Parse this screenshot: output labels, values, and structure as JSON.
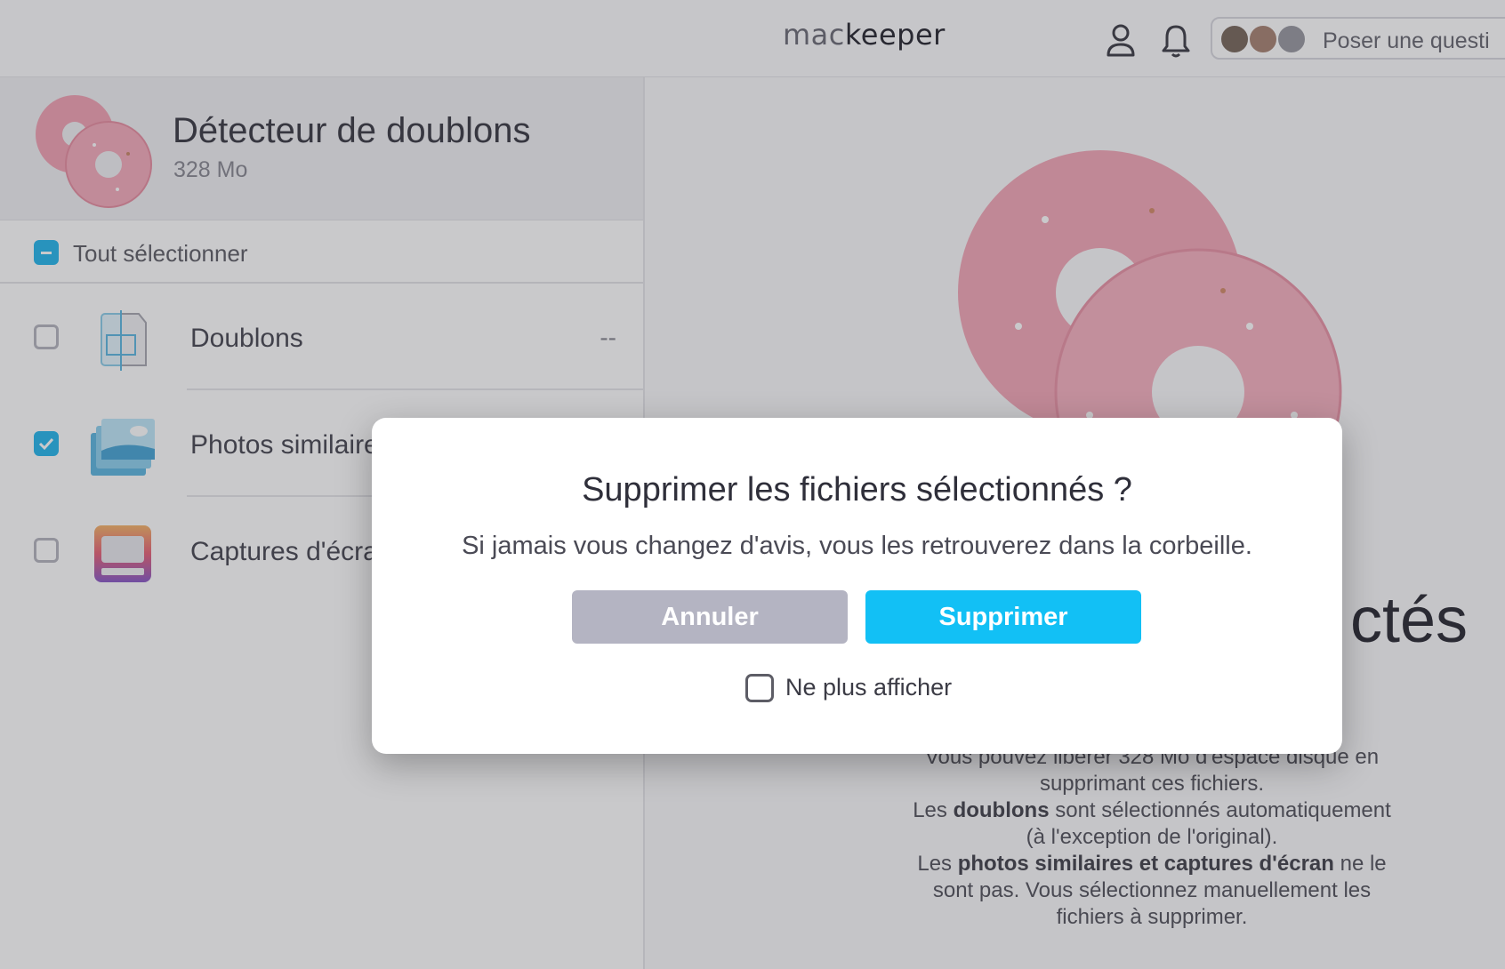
{
  "topbar": {
    "logo_mac": "mac",
    "logo_keeper": "keeper",
    "ask_placeholder": "Poser une questi"
  },
  "tool": {
    "title": "Détecteur de doublons",
    "size": "328 Mo"
  },
  "select_all": {
    "label": "Tout sélectionner",
    "state": "partial"
  },
  "categories": [
    {
      "label": "Doublons",
      "value": "--",
      "checked": false,
      "icon": "duplicate-files-icon"
    },
    {
      "label": "Photos similaire",
      "value": "",
      "checked": true,
      "icon": "similar-photos-icon"
    },
    {
      "label": "Captures d'écra",
      "value": "",
      "checked": false,
      "icon": "screenshots-icon"
    }
  ],
  "right": {
    "heading_fragment": "ctés",
    "desc_line1": "Vous pouvez libérer 328 Mo d'espace disque en supprimant ces fichiers.",
    "desc_line2_pre": "Les ",
    "desc_line2_bold": "doublons",
    "desc_line2_post": " sont sélectionnés automatiquement (à l'exception de l'original).",
    "desc_line3_pre": "Les ",
    "desc_line3_bold": "photos similaires et captures d'écran",
    "desc_line3_post": " ne le sont pas. Vous sélectionnez manuellement les fichiers à supprimer."
  },
  "dialog": {
    "title": "Supprimer les fichiers sélectionnés ?",
    "message": "Si jamais vous changez d'avis, vous les retrouverez dans la corbeille.",
    "cancel_label": "Annuler",
    "delete_label": "Supprimer",
    "dont_show_label": "Ne plus afficher",
    "dont_show_checked": false
  },
  "colors": {
    "accent": "#12c0f5",
    "cancel": "#b4b4c2",
    "donut": "#f2a3b4"
  }
}
